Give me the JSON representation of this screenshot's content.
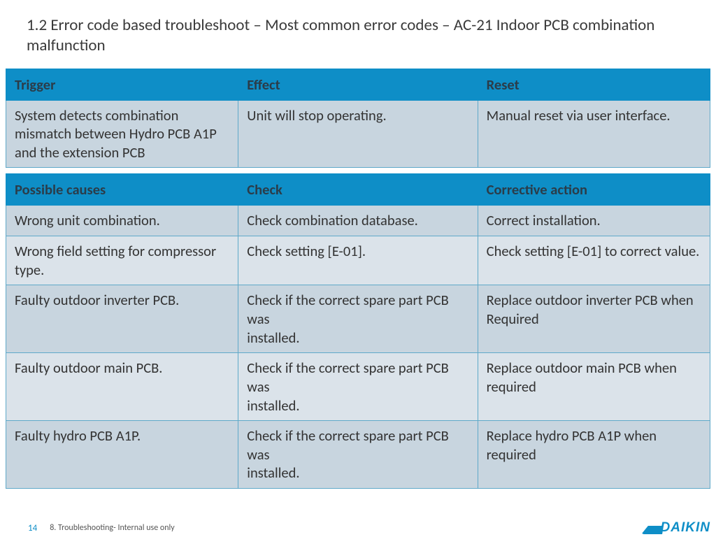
{
  "title": "1.2 Error code based troubleshoot –  Most common error codes – AC-21 Indoor PCB combination malfunction",
  "table1": {
    "headers": [
      "Trigger",
      "Effect",
      "Reset"
    ],
    "rows": [
      {
        "trigger": "System detects combination mismatch between Hydro PCB A1P and the extension PCB",
        "effect": "Unit will stop operating.",
        "reset": "Manual reset via user interface."
      }
    ]
  },
  "table2": {
    "headers": [
      "Possible causes",
      "Check",
      "Corrective action"
    ],
    "rows": [
      {
        "cause": "Wrong unit combination.",
        "check": "Check combination database.",
        "action": "Correct installation."
      },
      {
        "cause": "Wrong field setting for compressor type.",
        "check": "Check setting [E-01].",
        "action": "Check setting [E-01] to correct value."
      },
      {
        "cause": "Faulty outdoor inverter PCB.",
        "check": "Check if the correct spare part PCB was\ninstalled.",
        "action": "Replace outdoor inverter PCB when\nRequired"
      },
      {
        "cause": "Faulty outdoor main PCB.",
        "check": "Check if the correct spare part PCB was\ninstalled.",
        "action": "Replace outdoor main PCB when required"
      },
      {
        "cause": "Faulty hydro PCB A1P.",
        "check": "Check if the correct spare part PCB was\ninstalled.",
        "action": "Replace hydro PCB A1P when required"
      }
    ]
  },
  "footer": {
    "page": "14",
    "doc": "8. Troubleshooting- Internal use only",
    "brand": "DAIKIN"
  }
}
